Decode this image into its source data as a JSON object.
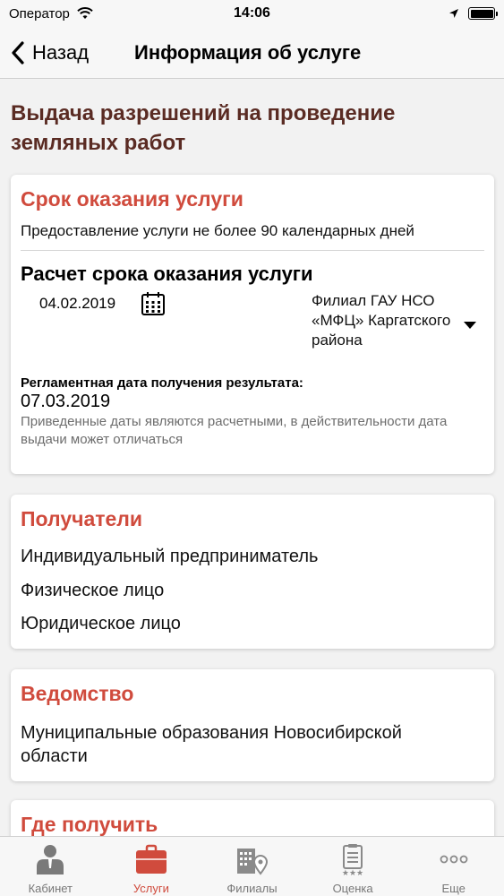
{
  "status_bar": {
    "carrier": "Оператор",
    "time": "14:06"
  },
  "nav": {
    "back_label": "Назад",
    "title": "Информация об услуге"
  },
  "service": {
    "title": "Выдача разрешений на проведение земляных работ"
  },
  "term_card": {
    "title": "Срок оказания услуги",
    "text": "Предоставление услуги не более 90 календарных дней",
    "calc_title": "Расчет срока оказания услуги",
    "date": "04.02.2019",
    "branch": "Филиал ГАУ НСО «МФЦ» Каргатского района",
    "result_label": "Регламентная дата получения результата:",
    "result_date": "07.03.2019",
    "note": "Приведенные даты являются расчетными, в действительности дата выдачи может отличаться"
  },
  "recipients_card": {
    "title": "Получатели",
    "items": [
      "Индивидуальный предприниматель",
      "Физическое лицо",
      "Юридическое лицо"
    ]
  },
  "agency_card": {
    "title": "Ведомство",
    "text": "Муниципальные образования Новосибирской области"
  },
  "where_card": {
    "title": "Где получить"
  },
  "tab_bar": {
    "tabs": [
      {
        "label": "Кабинет",
        "icon": "user-icon"
      },
      {
        "label": "Услуги",
        "icon": "briefcase-icon",
        "active": true
      },
      {
        "label": "Филиалы",
        "icon": "building-location-icon"
      },
      {
        "label": "Оценка",
        "icon": "clipboard-rating-icon"
      },
      {
        "label": "Еще",
        "icon": "more-dots-icon"
      }
    ]
  },
  "colors": {
    "accent": "#d04b3d",
    "service_title": "#5a2b23",
    "inactive_tab": "#777777"
  }
}
